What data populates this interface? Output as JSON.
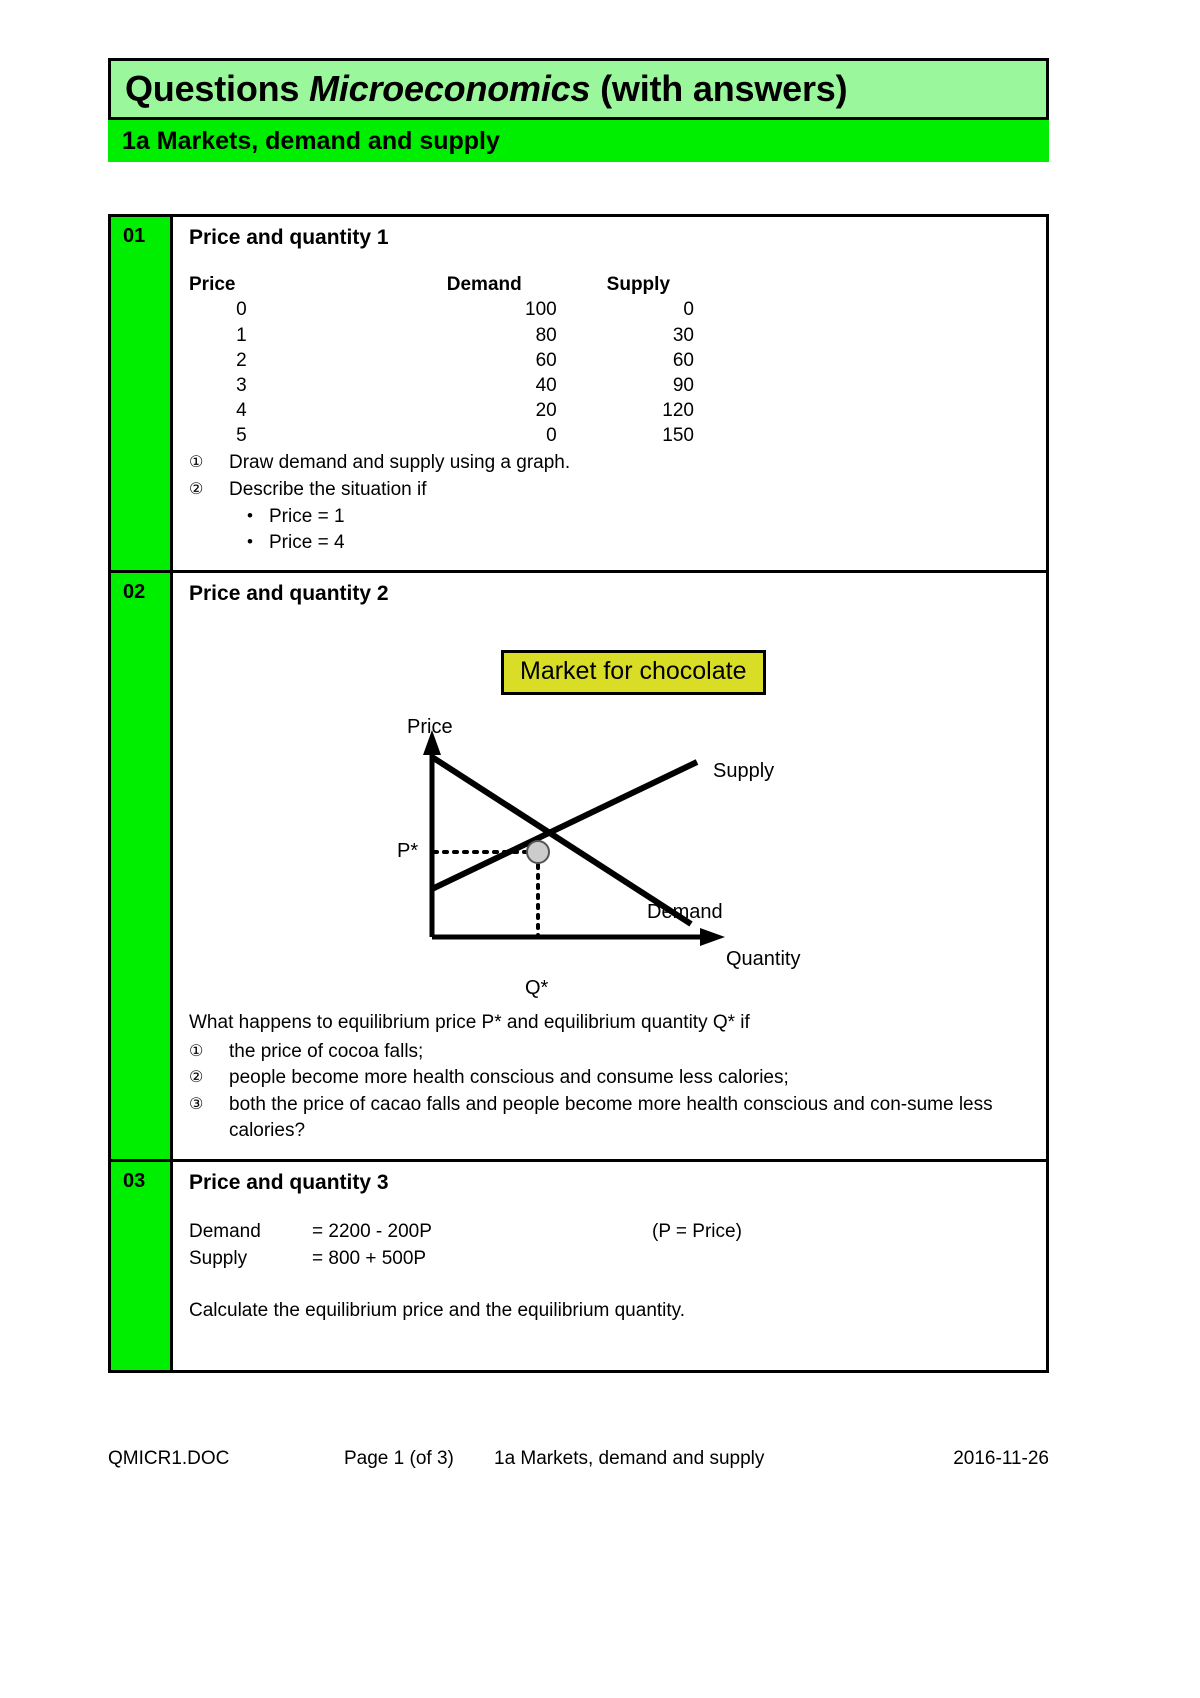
{
  "header": {
    "title_plain_1": "Questions ",
    "title_italic": "Microeconomics",
    "title_plain_2": " (with answers)",
    "subtitle": "1a  Markets, demand and supply",
    "title_bg": "#9bf79b",
    "subtitle_bg": "#00ef00"
  },
  "questions": [
    {
      "number": "01",
      "title": "Price and quantity 1",
      "table": {
        "headers": [
          "Price",
          "Demand",
          "Supply"
        ],
        "rows": [
          [
            "0",
            "100",
            "0"
          ],
          [
            "1",
            "80",
            "30"
          ],
          [
            "2",
            "60",
            "60"
          ],
          [
            "3",
            "40",
            "90"
          ],
          [
            "4",
            "20",
            "120"
          ],
          [
            "5",
            "0",
            "150"
          ]
        ]
      },
      "items": [
        {
          "marker": "①",
          "text": "Draw demand and supply using a graph."
        },
        {
          "marker": "②",
          "text": "Describe the situation if"
        }
      ],
      "bullets": [
        {
          "dot": "•",
          "text": "Price = 1"
        },
        {
          "dot": "•",
          "text": "Price = 4"
        }
      ]
    },
    {
      "number": "02",
      "title": "Price and quantity 2",
      "question_lead": "What happens to equilibrium price P* and equilibrium quantity Q* if",
      "items": [
        {
          "marker": "①",
          "text": "the price of cocoa falls;"
        },
        {
          "marker": "②",
          "text": "people become more health conscious and consume less calories;"
        },
        {
          "marker": "③",
          "text": "both the price of cacao falls and people become more health conscious and con-sume less calories?"
        }
      ]
    },
    {
      "number": "03",
      "title": "Price and quantity 3",
      "equations": [
        {
          "name": "Demand",
          "expr": "= 2200 - 200P",
          "note": "(P = Price)"
        },
        {
          "name": "Supply",
          "expr": "= 800 + 500P",
          "note": ""
        }
      ],
      "calculate": "Calculate the equilibrium price and the equilibrium quantity."
    }
  ],
  "chart_data": {
    "type": "line",
    "title": "Market for chocolate",
    "title_bg": "#d9dd26",
    "xlabel": "Quantity",
    "ylabel": "Price",
    "grid": false,
    "legend": "inline-labels",
    "series": [
      {
        "name": "Demand",
        "label": "Demand",
        "slope": "negative",
        "points": [
          [
            0,
            100
          ],
          [
            100,
            0
          ]
        ]
      },
      {
        "name": "Supply",
        "label": "Supply",
        "slope": "positive",
        "points": [
          [
            0,
            20
          ],
          [
            90,
            95
          ]
        ]
      }
    ],
    "annotations": [
      {
        "name": "equilibrium-point",
        "label": "",
        "marker": "circle",
        "fill": "#cccccc"
      },
      {
        "name": "equilibrium-price",
        "label": "P*",
        "axis": "y"
      },
      {
        "name": "equilibrium-quantity",
        "label": "Q*",
        "axis": "x"
      }
    ]
  },
  "footer": {
    "doc": "QMICR1.DOC",
    "page": "Page 1 (of 3)",
    "description": "1a Markets, demand and supply",
    "date": "2016-11-26"
  }
}
